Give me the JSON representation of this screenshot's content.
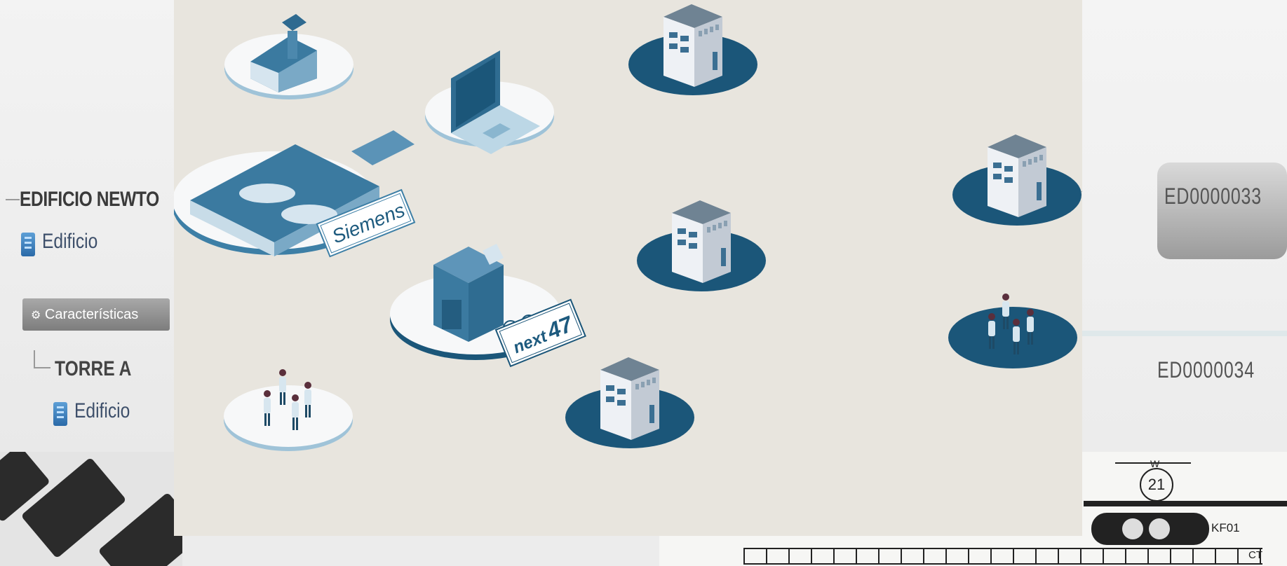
{
  "background_left": {
    "title": "EDIFICIO NEWTO",
    "item_edificio_1": "Edificio",
    "features_button": "Características",
    "subitem_title": "TORRE A",
    "item_edificio_2": "Edificio"
  },
  "background_right": {
    "code_1": "ED0000033",
    "code_2": "ED0000034"
  },
  "blueprint": {
    "ring_number": "21",
    "ring_label": "W",
    "label_kf": "KF01",
    "label_ct": "CT"
  },
  "illustration": {
    "sign_siemens": "Siemens",
    "sign_next47_word": "next",
    "sign_next47_num": "47"
  },
  "colors": {
    "panel_bg": "#e8e5de",
    "navy_platform": "#1b5679",
    "light_platform": "#f7f8f9",
    "platform_rim": "#9fc3d8",
    "building_light": "#d9dde3",
    "building_roof": "#6f8393",
    "building_blue": "#3b7aa0"
  }
}
